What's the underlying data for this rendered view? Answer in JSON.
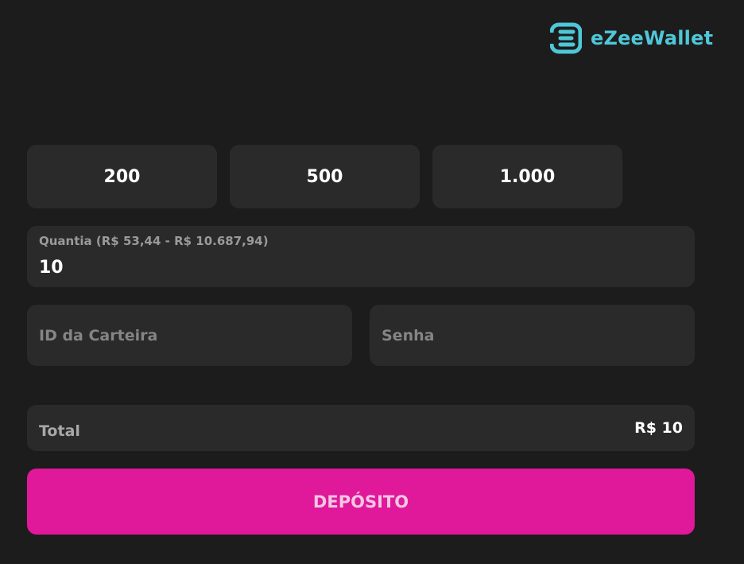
{
  "brand": {
    "name": "eZeeWallet",
    "color": "#4ec7d8"
  },
  "preset_amounts": [
    "200",
    "500",
    "1.000"
  ],
  "amount_field": {
    "label": "Quantia (R$ 53,44 - R$ 10.687,94)",
    "value": "10"
  },
  "wallet_id_field": {
    "placeholder": "ID da Carteira"
  },
  "password_field": {
    "placeholder": "Senha"
  },
  "total": {
    "label": "Total",
    "value": "R$ 10"
  },
  "deposit_button": {
    "label": "DEPÓSITO",
    "color": "#e0189a"
  },
  "colors": {
    "background": "#1c1c1c",
    "panel": "#2a2a2a"
  }
}
